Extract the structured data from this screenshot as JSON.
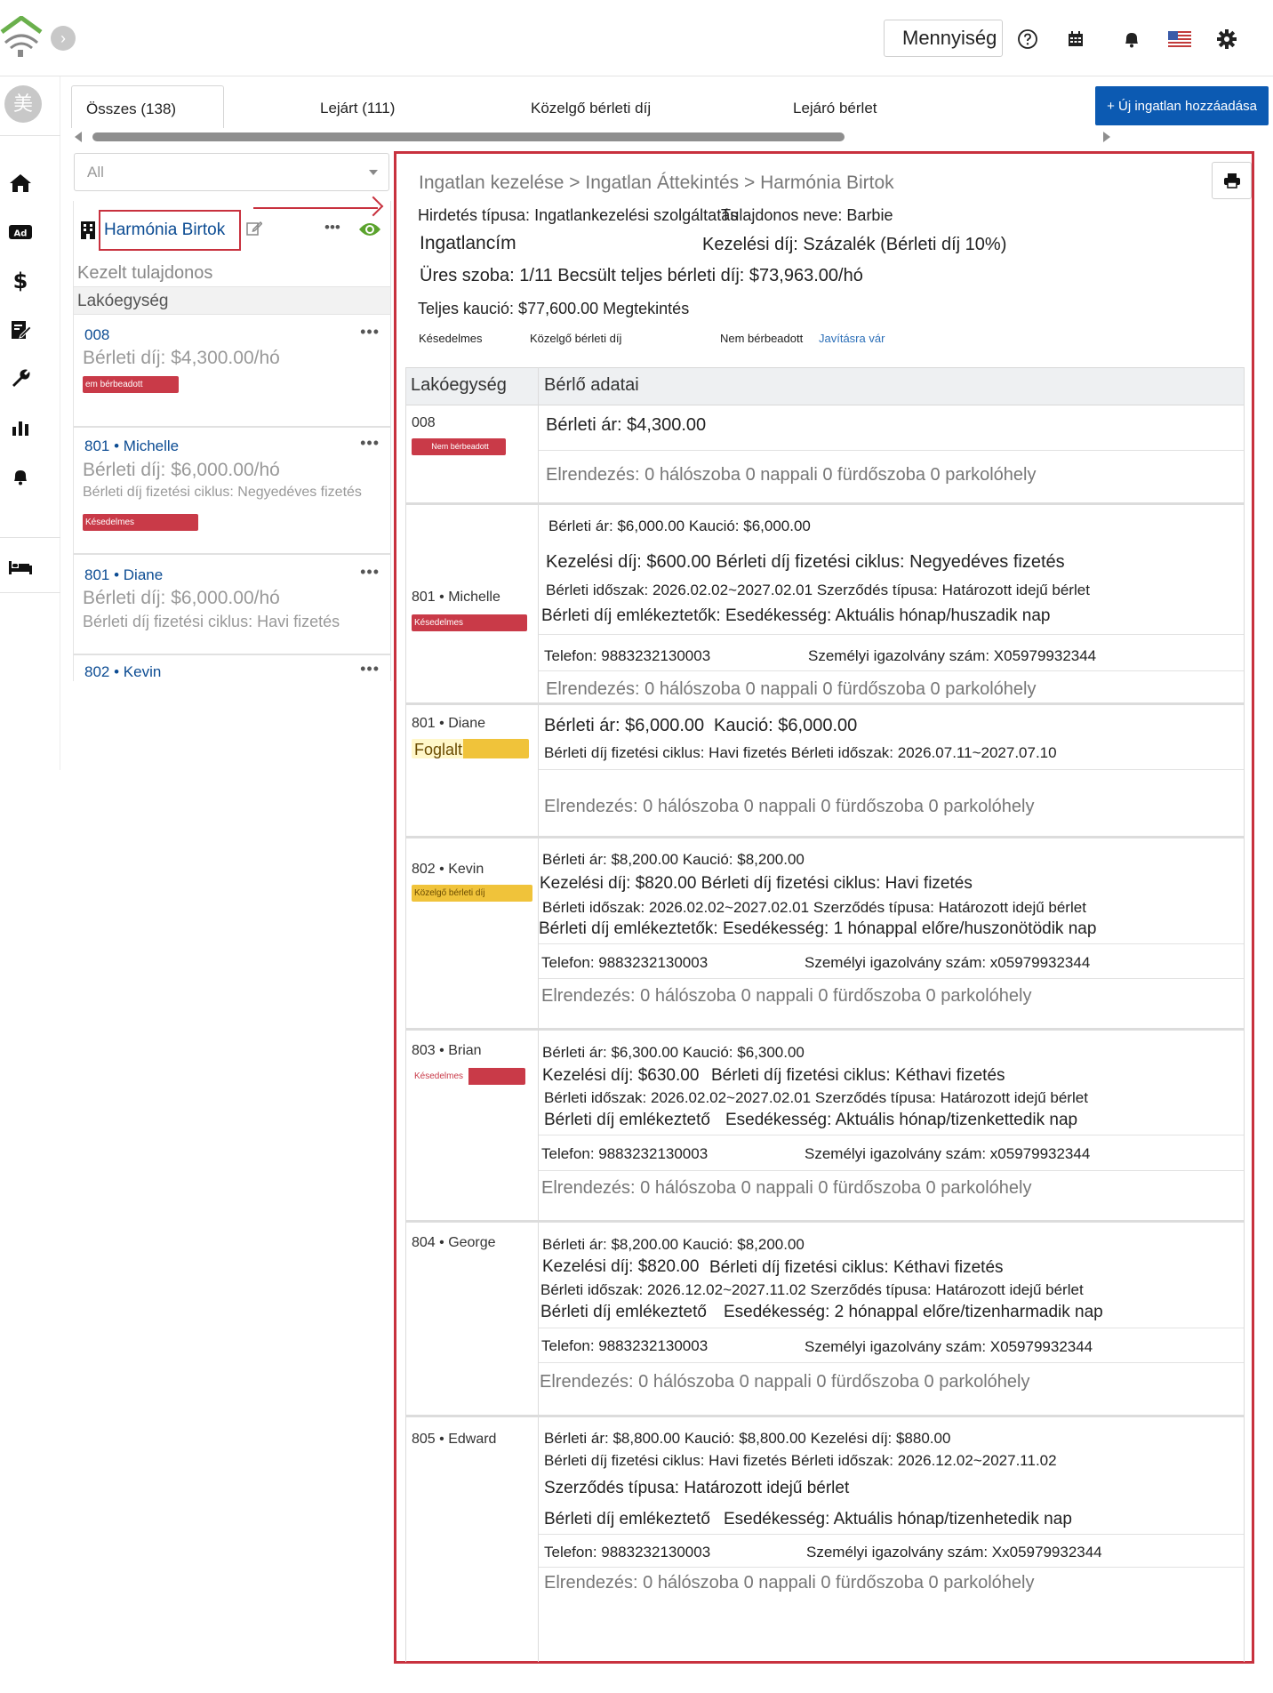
{
  "header": {
    "quantity_label": "Mennyiség",
    "avatar_text": "美",
    "collapse_glyph": "›"
  },
  "tabs": {
    "all": "Összes (138)",
    "expired": "Lejárt (111)",
    "upcoming_rent": "Közelgő bérleti díj",
    "expiring": "Lejáró bérlet",
    "add_button": "+ Új ingatlan hozzáadása"
  },
  "filter": {
    "selected": "All"
  },
  "property": {
    "name": "Harmónia Birtok",
    "owner_label": "Kezelt tulajdonos",
    "unit_section": "Lakóegység"
  },
  "left_units": [
    {
      "id": "008",
      "tenant": "",
      "rent": "Bérleti díj: $4,300.00/hó",
      "cycle": "",
      "badge": "em bérbeadott"
    },
    {
      "id": "801",
      "tenant": "Michelle",
      "rent": "Bérleti díj: $6,000.00/hó",
      "cycle": "Bérleti díj fizetési ciklus: Negyedéves fizetés",
      "badge": "Késedelmes"
    },
    {
      "id": "801",
      "tenant": "Diane",
      "rent": "Bérleti díj: $6,000.00/hó",
      "cycle": "Bérleti díj fizetési ciklus: Havi fizetés",
      "badge": ""
    },
    {
      "id": "802",
      "tenant": "Kevin",
      "rent": "",
      "cycle": "",
      "badge": ""
    }
  ],
  "dots": "•••",
  "sep": " • ",
  "detail": {
    "breadcrumb": "Ingatlan kezelése > Ingatlan Áttekintés > Harmónia Birtok",
    "ad_type": "Hirdetés típusa: Ingatlankezelési szolgáltatás",
    "owner": "Tulajdonos neve: Barbie",
    "address_label": "Ingatlancím",
    "mgmt_fee": "Kezelési díj: Százalék (Bérleti díj 10%)",
    "vacancy": "Üres szoba: 1/11 Becsült teljes bérleti díj: $73,963.00/hó",
    "deposit": "Teljes kaució: $77,600.00 Megtekintés",
    "filter_late": "Késedelmes",
    "filter_upcoming": "Közelgő bérleti díj",
    "filter_unrented": "Nem bérbeadott",
    "filter_repair": "Javításra vár",
    "col_unit": "Lakóegység",
    "col_tenant": "Bérlő adatai"
  },
  "blocks": [
    {
      "name": "008",
      "badge": "Nem bérbeadott",
      "badge_color": "#c93a48",
      "l1": "Bérleti ár: $4,300.00",
      "layout": "Elrendezés: 0 hálószoba 0 nappali 0 fürdőszoba 0 parkolóhely"
    },
    {
      "name": "801 • Michelle",
      "badge": "Késedelmes",
      "badge_color": "#c93a48",
      "l1": "Bérleti ár: $6,000.00  Kaució: $6,000.00",
      "l2": "Kezelési díj: $600.00 Bérleti díj fizetési ciklus: Negyedéves fizetés",
      "l3": "Bérleti időszak: 2026.02.02~2027.02.01 Szerződés típusa: Határozott idejű bérlet",
      "l4": "Bérleti díj emlékeztetők: Esedékesség: Aktuális hónap/huszadik nap",
      "phone": "Telefon: 9883232130003",
      "idno": "Személyi igazolvány szám: X05979932344",
      "layout": "Elrendezés: 0 hálószoba 0 nappali 0 fürdőszoba 0 parkolóhely"
    },
    {
      "name": "801 • Diane",
      "badge": "Foglalt",
      "badge_color": "#f0c33a",
      "l1a": "Bérleti ár: $6,000.00",
      "l1b": "Kaució: $6,000.00",
      "l2": "Bérleti díj fizetési ciklus: Havi fizetés Bérleti időszak: 2026.07.11~2027.07.10",
      "layout": "Elrendezés: 0 hálószoba 0 nappali 0 fürdőszoba 0 parkolóhely"
    },
    {
      "name": "802 • Kevin",
      "badge": "Közelgő bérleti díj",
      "badge_color": "#f0c33a",
      "l1": "Bérleti ár: $8,200.00   Kaució: $8,200.00",
      "l2": "Kezelési díj: $820.00 Bérleti díj fizetési ciklus: Havi fizetés",
      "l3": "Bérleti időszak: 2026.02.02~2027.02.01 Szerződés típusa: Határozott idejű bérlet",
      "l4": "Bérleti díj emlékeztetők: Esedékesség: 1 hónappal előre/huszonötödik nap",
      "phone": "Telefon: 9883232130003",
      "idno": "Személyi igazolvány szám: x05979932344",
      "layout": "Elrendezés: 0 hálószoba 0 nappali 0 fürdőszoba 0 parkolóhely"
    },
    {
      "name": "803 • Brian",
      "badge": "Késedelmes",
      "badge_color": "#c93a48",
      "l1": "Bérleti ár: $6,300.00   Kaució: $6,300.00",
      "l2a": "Kezelési díj: $630.00",
      "l2b": "Bérleti díj fizetési ciklus: Kéthavi fizetés",
      "l3": "Bérleti időszak: 2026.02.02~2027.02.01 Szerződés típusa: Határozott idejű bérlet",
      "l4a": "Bérleti díj emlékeztető",
      "l4b": "Esedékesség: Aktuális hónap/tizenkettedik nap",
      "phone": "Telefon: 9883232130003",
      "idno": "Személyi igazolvány szám: x05979932344",
      "layout": "Elrendezés: 0 hálószoba 0 nappali 0 fürdőszoba 0 parkolóhely"
    },
    {
      "name": "804 • George",
      "badge": "",
      "badge_color": "",
      "l1": "Bérleti ár: $8,200.00   Kaució: $8,200.00",
      "l2a": "Kezelési díj: $820.00",
      "l2b": "Bérleti díj fizetési ciklus: Kéthavi fizetés",
      "l3": "Bérleti időszak: 2026.12.02~2027.11.02 Szerződés típusa: Határozott idejű bérlet",
      "l4a": "Bérleti díj emlékeztető",
      "l4b": "Esedékesség: 2 hónappal előre/tizenharmadik nap",
      "phone": "Telefon: 9883232130003",
      "idno": "Személyi igazolvány szám: X05979932344",
      "layout": "Elrendezés: 0 hálószoba 0 nappali 0 fürdőszoba 0 parkolóhely"
    },
    {
      "name": "805 • Edward",
      "badge": "",
      "badge_color": "",
      "l1": "Bérleti ár: $8,800.00  Kaució: $8,800.00 Kezelési díj: $880.00",
      "l2": "Bérleti díj fizetési ciklus: Havi fizetés Bérleti időszak: 2026.12.02~2027.11.02",
      "l3": "Szerződés típusa: Határozott idejű bérlet",
      "l4a": "Bérleti díj emlékeztető",
      "l4b": "Esedékesség: Aktuális hónap/tizenhetedik nap",
      "phone": "Telefon: 9883232130003",
      "idno": "Személyi igazolvány szám: Xx05979932344",
      "layout": "Elrendezés: 0 hálószoba 0 nappali 0 fürdőszoba 0 parkolóhely"
    }
  ],
  "colors": {
    "accent": "#c8313e",
    "brand_blue": "#0c5ab2",
    "link": "#0c4c93",
    "late_red": "#c93a48",
    "busy_yellow": "#f0c33a"
  },
  "icons": [
    "home-logo-icon",
    "chevron-right-icon",
    "help-icon",
    "calendar-icon",
    "bell-icon",
    "us-flag-icon",
    "gear-icon",
    "home-icon",
    "ad-icon",
    "dollar-icon",
    "contract-icon",
    "wrench-icon",
    "chart-icon",
    "bell-icon",
    "bed-icon",
    "building-icon",
    "edit-icon",
    "eye-icon",
    "print-icon"
  ]
}
